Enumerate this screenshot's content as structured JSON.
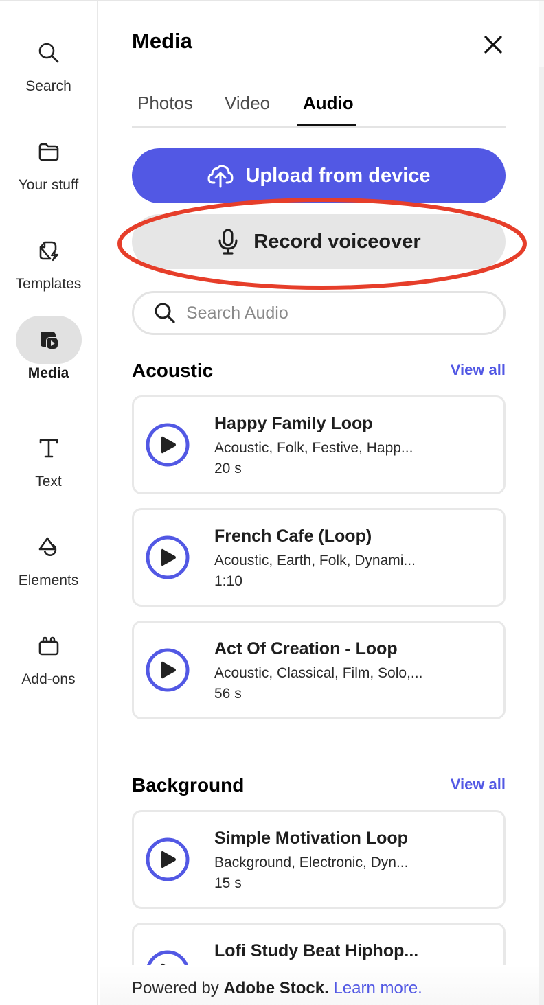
{
  "sidebar": {
    "items": [
      {
        "id": "search",
        "label": "Search",
        "icon": "search-icon",
        "active": false
      },
      {
        "id": "your-stuff",
        "label": "Your stuff",
        "icon": "folder-icon",
        "active": false
      },
      {
        "id": "templates",
        "label": "Templates",
        "icon": "templates-icon",
        "active": false
      },
      {
        "id": "media",
        "label": "Media",
        "icon": "media-icon",
        "active": true
      },
      {
        "id": "text",
        "label": "Text",
        "icon": "text-icon",
        "active": false
      },
      {
        "id": "elements",
        "label": "Elements",
        "icon": "shapes-icon",
        "active": false
      },
      {
        "id": "add-ons",
        "label": "Add-ons",
        "icon": "add-ons-icon",
        "active": false
      }
    ]
  },
  "panel": {
    "title": "Media",
    "close_icon": "close-icon",
    "tabs": [
      {
        "label": "Photos",
        "active": false
      },
      {
        "label": "Video",
        "active": false
      },
      {
        "label": "Audio",
        "active": true
      }
    ],
    "upload_label": "Upload from device",
    "upload_icon": "cloud-upload-icon",
    "record_label": "Record voiceover",
    "record_icon": "microphone-icon",
    "search_placeholder": "Search Audio",
    "search_value": "",
    "annotation": {
      "type": "ellipse",
      "color": "#e63e2a",
      "target": "record-voiceover-button"
    }
  },
  "sections": [
    {
      "title": "Acoustic",
      "view_all": "View all",
      "tracks": [
        {
          "name": "Happy Family Loop",
          "tags": "Acoustic, Folk, Festive, Happ...",
          "duration": "20 s"
        },
        {
          "name": "French Cafe (Loop)",
          "tags": "Acoustic, Earth, Folk, Dynami...",
          "duration": "1:10"
        },
        {
          "name": "Act Of Creation - Loop",
          "tags": "Acoustic, Classical, Film, Solo,...",
          "duration": "56 s"
        }
      ]
    },
    {
      "title": "Background",
      "view_all": "View all",
      "tracks": [
        {
          "name": "Simple Motivation Loop",
          "tags": "Background, Electronic, Dyn...",
          "duration": "15 s"
        },
        {
          "name": "Lofi Study Beat Hiphop...",
          "tags": "",
          "duration": ""
        }
      ]
    }
  ],
  "footer": {
    "prefix": "Powered by ",
    "brand": "Adobe Stock.",
    "link": "Learn more."
  },
  "colors": {
    "accent": "#5258e4",
    "annotation": "#e63e2a",
    "secondary_button": "#e6e6e6",
    "active_rail": "#e1e1e1"
  }
}
